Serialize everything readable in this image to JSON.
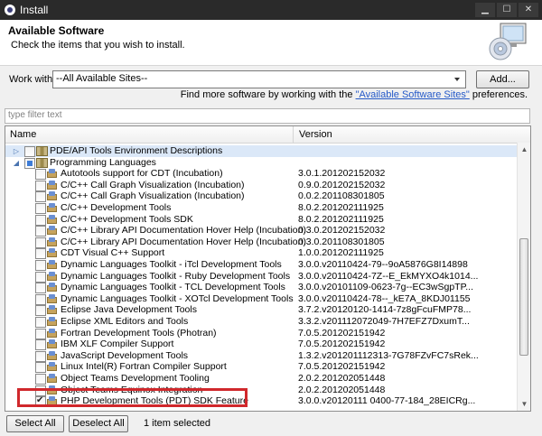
{
  "window": {
    "title": "Install"
  },
  "header": {
    "title": "Available Software",
    "description": "Check the items that you wish to install."
  },
  "work_with": {
    "label": "Work with:",
    "value": "--All Available Sites--",
    "add_label": "Add..."
  },
  "find_more": {
    "prefix": "Find more software by working with the ",
    "link": "\"Available Software Sites\"",
    "suffix": " preferences."
  },
  "filter": {
    "placeholder": "type filter text"
  },
  "table": {
    "columns": [
      "Name",
      "Version"
    ],
    "rows": [
      {
        "name": "PDE/API Tools Environment Descriptions",
        "version": "",
        "level": 0,
        "kind": "category",
        "twisty": "▷",
        "check": "none"
      },
      {
        "name": "Programming Languages",
        "version": "",
        "level": 0,
        "kind": "category",
        "twisty": "◢",
        "check": "tri"
      },
      {
        "name": "Autotools support for CDT (Incubation)",
        "version": "3.0.1.201202152032",
        "level": 1,
        "kind": "feature",
        "check": "none"
      },
      {
        "name": "C/C++ Call Graph Visualization (Incubation)",
        "version": "0.9.0.201202152032",
        "level": 1,
        "kind": "feature",
        "check": "none"
      },
      {
        "name": "C/C++ Call Graph Visualization (Incubation)",
        "version": "0.0.2.201108301805",
        "level": 1,
        "kind": "feature",
        "check": "none"
      },
      {
        "name": "C/C++ Development Tools",
        "version": "8.0.2.201202111925",
        "level": 1,
        "kind": "feature",
        "check": "none"
      },
      {
        "name": "C/C++ Development Tools SDK",
        "version": "8.0.2.201202111925",
        "level": 1,
        "kind": "feature",
        "check": "none"
      },
      {
        "name": "C/C++ Library API Documentation Hover Help (Incubation)",
        "version": "0.3.0.201202152032",
        "level": 1,
        "kind": "feature",
        "check": "none"
      },
      {
        "name": "C/C++ Library API Documentation Hover Help (Incubation)",
        "version": "0.3.0.201108301805",
        "level": 1,
        "kind": "feature",
        "check": "none"
      },
      {
        "name": "CDT Visual C++ Support",
        "version": "1.0.0.201202111925",
        "level": 1,
        "kind": "feature",
        "check": "none"
      },
      {
        "name": "Dynamic Languages Toolkit - iTcl Development Tools",
        "version": "3.0.0.v20110424-79--9oA5876G8I14898",
        "level": 1,
        "kind": "feature",
        "check": "none"
      },
      {
        "name": "Dynamic Languages Toolkit - Ruby Development Tools",
        "version": "3.0.0.v20110424-7Z--E_EkMYXO4k1014...",
        "level": 1,
        "kind": "feature",
        "check": "none"
      },
      {
        "name": "Dynamic Languages Toolkit - TCL Development Tools",
        "version": "3.0.0.v20101109-0623-7g--EC3wSgpTP...",
        "level": 1,
        "kind": "feature",
        "check": "none"
      },
      {
        "name": "Dynamic Languages Toolkit - XOTcl Development Tools",
        "version": "3.0.0.v20110424-78--_kE7A_8KDJ01155",
        "level": 1,
        "kind": "feature",
        "check": "none"
      },
      {
        "name": "Eclipse Java Development Tools",
        "version": "3.7.2.v20120120-1414-7z8gFcuFMP78...",
        "level": 1,
        "kind": "feature",
        "check": "none"
      },
      {
        "name": "Eclipse XML Editors and Tools",
        "version": "3.3.2.v201112072049-7H7EFZ7DxumT...",
        "level": 1,
        "kind": "feature",
        "check": "none"
      },
      {
        "name": "Fortran Development Tools (Photran)",
        "version": "7.0.5.201202151942",
        "level": 1,
        "kind": "feature",
        "check": "none"
      },
      {
        "name": "IBM XLF Compiler Support",
        "version": "7.0.5.201202151942",
        "level": 1,
        "kind": "feature",
        "check": "none"
      },
      {
        "name": "JavaScript Development Tools",
        "version": "1.3.2.v201201112313-7G78FZvFC7sRek...",
        "level": 1,
        "kind": "feature",
        "check": "none"
      },
      {
        "name": "Linux Intel(R) Fortran Compiler Support",
        "version": "7.0.5.201202151942",
        "level": 1,
        "kind": "feature",
        "check": "none"
      },
      {
        "name": "Object Teams Development Tooling",
        "version": "2.0.2.201202051448",
        "level": 1,
        "kind": "feature",
        "check": "none"
      },
      {
        "name": "Object Teams Equinox Integration",
        "version": "2.0.2.201202051448",
        "level": 1,
        "kind": "feature",
        "check": "none"
      },
      {
        "name": "PHP Development Tools (PDT) SDK Feature",
        "version": "3.0.0.v20120111 0400-77-184_28EICRg...",
        "level": 1,
        "kind": "feature",
        "check": "checked"
      }
    ]
  },
  "bottom": {
    "select_all": "Select All",
    "deselect_all": "Deselect All",
    "count": "1 item selected"
  }
}
